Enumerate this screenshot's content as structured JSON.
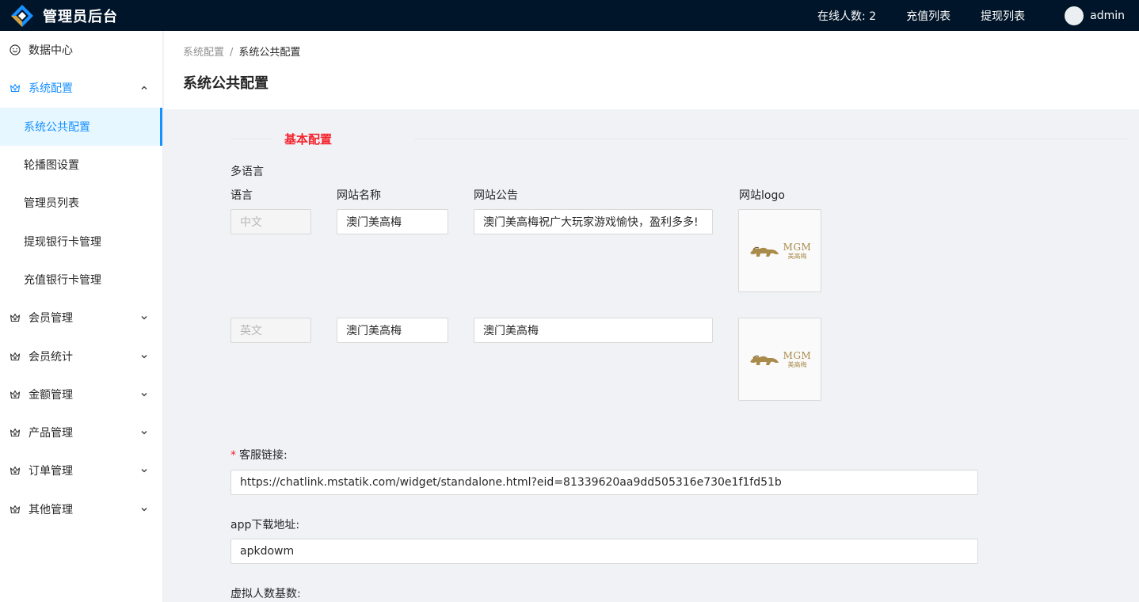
{
  "header": {
    "title": "管理员后台",
    "online_label": "在线人数: 2",
    "recharge_list": "充值列表",
    "withdraw_list": "提现列表",
    "username": "admin"
  },
  "sidebar": {
    "items": [
      {
        "label": "数据中心",
        "icon": "smile-icon"
      },
      {
        "label": "系统配置",
        "icon": "crown-icon",
        "open": true,
        "children": [
          "系统公共配置",
          "轮播图设置",
          "管理员列表",
          "提现银行卡管理",
          "充值银行卡管理"
        ]
      },
      {
        "label": "会员管理",
        "icon": "crown-icon"
      },
      {
        "label": "会员统计",
        "icon": "crown-icon"
      },
      {
        "label": "金额管理",
        "icon": "crown-icon"
      },
      {
        "label": "产品管理",
        "icon": "crown-icon"
      },
      {
        "label": "订单管理",
        "icon": "crown-icon"
      },
      {
        "label": "其他管理",
        "icon": "crown-icon"
      }
    ],
    "active_child": "系统公共配置"
  },
  "breadcrumb": {
    "parent": "系统配置",
    "separator": "/",
    "current": "系统公共配置"
  },
  "page_title": "系统公共配置",
  "form": {
    "section_title": "基本配置",
    "multilang_label": "多语言",
    "columns": {
      "lang": "语言",
      "site_name": "网站名称",
      "notice": "网站公告",
      "logo": "网站logo"
    },
    "rows": [
      {
        "lang": "中文",
        "site_name": "澳门美高梅",
        "notice": "澳门美高梅祝广大玩家游戏愉快，盈利多多!",
        "logo_text": "MGM",
        "logo_sub": "美高梅"
      },
      {
        "lang": "英文",
        "site_name": "澳门美高梅",
        "notice": "澳门美高梅",
        "logo_text": "MGM",
        "logo_sub": "美高梅"
      }
    ],
    "service_link_label": "客服链接:",
    "service_link_required": "*",
    "service_link_value": "https://chatlink.mstatik.com/widget/standalone.html?eid=81339620aa9dd505316e730e1f1fd51b",
    "app_download_label": "app下载地址:",
    "app_download_value": "apkdowm",
    "virtual_base_label": "虚拟人数基数:"
  },
  "colors": {
    "header_bg": "#001529",
    "primary": "#1890ff",
    "danger": "#f5222d"
  }
}
